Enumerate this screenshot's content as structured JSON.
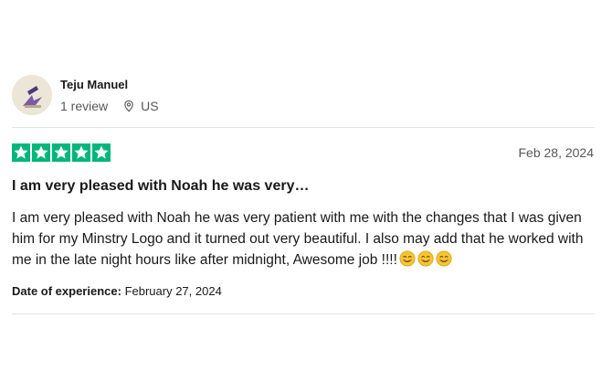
{
  "reviewer": {
    "name": "Teju Manuel",
    "review_count": "1 review",
    "country": "US",
    "avatar_icon": "avatar-image"
  },
  "review": {
    "rating": 5,
    "max_rating": 5,
    "star_color": "#00b67a",
    "date": "Feb 28, 2024",
    "title": "I am very pleased with Noah he was very…",
    "body": "I am very pleased with Noah he was very patient with me with the changes that I was given him for my Minstry Logo and it turned out very beautiful. I also may add that he worked with me in the late night hours like after midnight, Awesome job !!!!",
    "emoji_count": 3,
    "emoji_icon": "smiling-face-icon",
    "experience_label": "Date of experience:",
    "experience_date": "February 27, 2024"
  }
}
